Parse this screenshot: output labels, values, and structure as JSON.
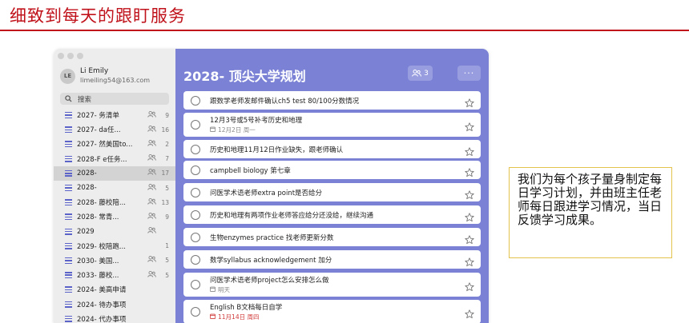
{
  "slide": {
    "title": "细致到每天的跟盯服务"
  },
  "window": {
    "profile": {
      "initials": "LE",
      "name": "Li Emily",
      "email": "limeiling54@163.com"
    },
    "search": {
      "label": "搜索"
    },
    "lists": [
      {
        "label": "2027-  务清单",
        "shared": true,
        "count": "9",
        "selected": false
      },
      {
        "label": "2027-  da任...",
        "shared": true,
        "count": "16",
        "selected": false
      },
      {
        "label": "2027-  然美国to...",
        "shared": true,
        "count": "2",
        "selected": false
      },
      {
        "label": "2028-F  e任务...",
        "shared": true,
        "count": "7",
        "selected": false
      },
      {
        "label": "2028-   ",
        "shared": true,
        "count": "17",
        "selected": true
      },
      {
        "label": "2028-",
        "shared": true,
        "count": "5",
        "selected": false
      },
      {
        "label": "2028-  藤校陪...",
        "shared": true,
        "count": "13",
        "selected": false
      },
      {
        "label": "2028-  常青...",
        "shared": true,
        "count": "9",
        "selected": false
      },
      {
        "label": "2029  ",
        "shared": true,
        "count": "",
        "selected": false
      },
      {
        "label": "2029-  校陪跑...",
        "shared": false,
        "count": "1",
        "selected": false
      },
      {
        "label": "2030-  美国...",
        "shared": true,
        "count": "5",
        "selected": false
      },
      {
        "label": "2033-  藤校...",
        "shared": true,
        "count": "5",
        "selected": false
      },
      {
        "label": "2024-  美高申请",
        "shared": false,
        "count": "",
        "selected": false
      },
      {
        "label": "2024-  待办事项",
        "shared": false,
        "count": "",
        "selected": false
      },
      {
        "label": "2024-  代办事项",
        "shared": false,
        "count": "",
        "selected": false
      }
    ],
    "main": {
      "title": "2028-     顶尖大学规划",
      "share_count": "3",
      "more_label": "···",
      "tasks": [
        {
          "text": "跟数学老师发邮件确认ch5 test 80/100分数情况",
          "date": "",
          "overdue": false
        },
        {
          "text": "12月3号或5号补考历史和地理",
          "date": "12月2日 周一",
          "overdue": false
        },
        {
          "text": "历史和地理11月12日作业缺失，跟老师确认",
          "date": "",
          "overdue": false
        },
        {
          "text": "campbell biology 第七章",
          "date": "",
          "overdue": false
        },
        {
          "text": "问医学术语老师extra point是否给分",
          "date": "",
          "overdue": false
        },
        {
          "text": "历史和地理有两项作业老师答应给分还没给，继续沟通",
          "date": "",
          "overdue": false
        },
        {
          "text": "生物enzymes practice 找老师更新分数",
          "date": "",
          "overdue": false
        },
        {
          "text": "数学syllabus acknowledgement 加分",
          "date": "",
          "overdue": false
        },
        {
          "text": "问医学术语老师project怎么安排怎么做",
          "date": "明天",
          "overdue": false
        },
        {
          "text": "English B文档每日自学",
          "date": "11月14日 周四",
          "overdue": true
        }
      ]
    }
  },
  "note": {
    "text": "我们为每个孩子量身制定每日学习计划，并由班主任老师每日跟进学习情况，当日反馈学习成果。"
  },
  "colors": {
    "title_red": "#c0121b",
    "accent_purple": "#7b82d6",
    "list_icon": "#5b63c9",
    "note_border": "#e3c34b",
    "overdue": "#d03a3a"
  },
  "icons": {
    "search": "search-icon",
    "shared": "people-icon",
    "list": "list-icon",
    "star": "star-icon",
    "calendar": "calendar-icon",
    "checkbox": "circle-checkbox-icon"
  }
}
